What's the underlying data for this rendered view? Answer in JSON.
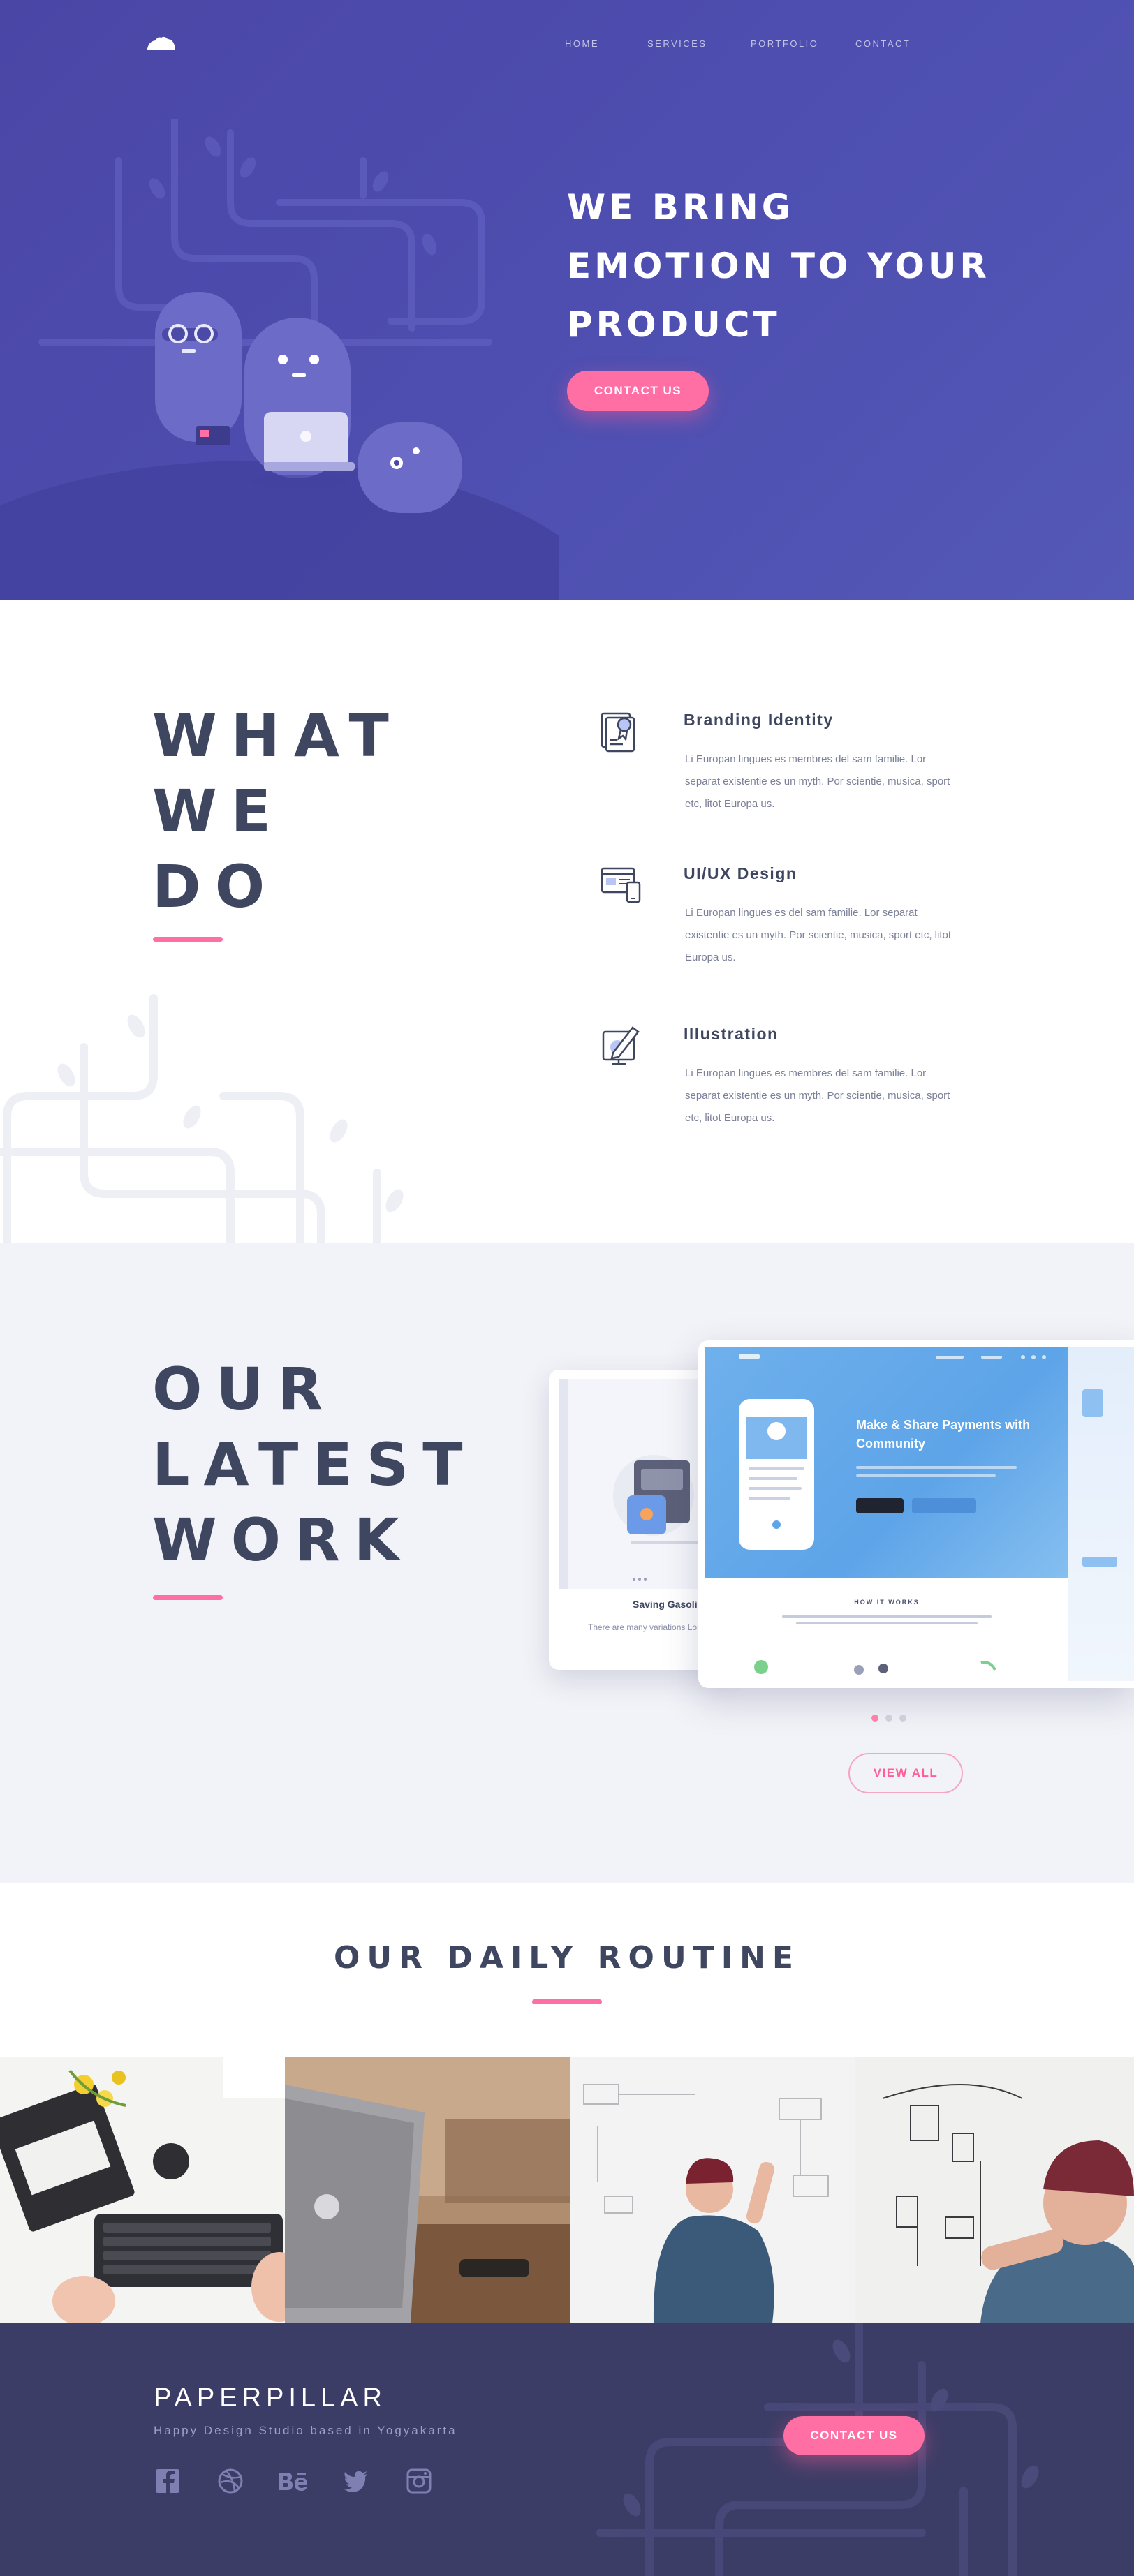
{
  "nav": {
    "items": [
      "HOME",
      "SERVICES",
      "PORTFOLIO",
      "CONTACT"
    ]
  },
  "hero": {
    "title_lines": [
      "WE BRING",
      "EMOTION TO YOUR",
      "PRODUCT"
    ],
    "cta": "CONTACT US"
  },
  "what_we_do": {
    "heading_lines": [
      "WHAT",
      "WE",
      "DO"
    ],
    "services": [
      {
        "icon": "branding-award-icon",
        "title": "Branding Identity",
        "text": "Li Europan lingues es membres del sam familie. Lor separat existentie es un myth. Por scientie, musica, sport etc, litot Europa us."
      },
      {
        "icon": "uiux-devices-icon",
        "title": "UI/UX Design",
        "text": "Li Europan lingues es del sam familie. Lor separat existentie es un myth. Por scientie, musica, sport etc, litot Europa us."
      },
      {
        "icon": "illustration-pen-icon",
        "title": "Illustration",
        "text": "Li Europan lingues es membres del sam familie. Lor separat existentie es un myth. Por scientie, musica, sport etc, litot Europa us."
      }
    ]
  },
  "latest_work": {
    "heading_lines": [
      "OUR",
      "LATEST",
      "WORK"
    ],
    "main_card": {
      "headline": "Make & Share Payments with Community",
      "section_label": "HOW IT WORKS"
    },
    "back_card": {
      "title": "Saving Gasoli",
      "text": "There are many variations Lorem Ipsum available, bu"
    },
    "slides": 3,
    "active_slide": 0,
    "view_all": "VIEW ALL"
  },
  "daily_routine": {
    "heading": "OUR DAILY ROUTINE"
  },
  "footer": {
    "brand": "PAPERPILLAR",
    "tagline": "Happy Design Studio based in Yogyakarta",
    "socials": [
      "facebook-icon",
      "dribbble-icon",
      "behance-icon",
      "twitter-icon",
      "instagram-icon"
    ],
    "cta": "CONTACT US"
  },
  "colors": {
    "hero_bg": "#4e4fb1",
    "accent_pink": "#ff6fa4",
    "heading_dark": "#3f4660",
    "work_bg": "#f2f3f8",
    "footer_bg": "#3c3d66"
  }
}
